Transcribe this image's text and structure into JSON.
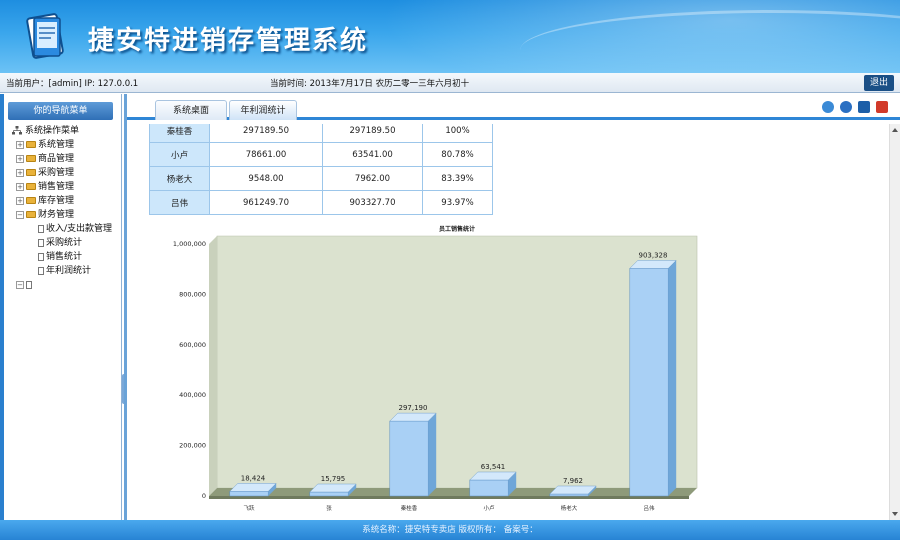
{
  "header": {
    "app_title": "捷安特进销存管理系统"
  },
  "infobar": {
    "current_user": "当前用户：[admin] IP: 127.0.0.1",
    "current_time": "当前时间:  2013年7月17日  农历二零一三年六月初十",
    "logout_label": "退出"
  },
  "sidebar": {
    "title": "你的导航菜单",
    "root_label": "系统操作菜单",
    "items": [
      {
        "label": "系统管理"
      },
      {
        "label": "商品管理"
      },
      {
        "label": "采购管理"
      },
      {
        "label": "销售管理"
      },
      {
        "label": "库存管理"
      },
      {
        "label": "财务管理"
      }
    ],
    "finance_children": [
      {
        "label": "收入/支出款管理"
      },
      {
        "label": "采购统计"
      },
      {
        "label": "销售统计"
      },
      {
        "label": "年利润统计"
      }
    ]
  },
  "tabs": [
    {
      "label": "系统桌面"
    },
    {
      "label": "年利润统计"
    }
  ],
  "table": {
    "rows": [
      {
        "name": "秦桂香",
        "v1": "297189.50",
        "v2": "297189.50",
        "v3": "100%"
      },
      {
        "name": "小卢",
        "v1": "78661.00",
        "v2": "63541.00",
        "v3": "80.78%"
      },
      {
        "name": "杨老大",
        "v1": "9548.00",
        "v2": "7962.00",
        "v3": "83.39%"
      },
      {
        "name": "吕伟",
        "v1": "961249.70",
        "v2": "903327.70",
        "v3": "93.97%"
      }
    ]
  },
  "chart_data": {
    "type": "bar",
    "title": "员工销售统计",
    "categories": [
      "飞跃",
      "张",
      "秦桂香",
      "小卢",
      "杨老大",
      "吕伟"
    ],
    "values": [
      18424,
      15795,
      297190,
      63541,
      7962,
      903328
    ],
    "value_labels": [
      "18,424",
      "15,795",
      "297,190",
      "63,541",
      "7,962",
      "903,328"
    ],
    "ylim": [
      0,
      1000000
    ],
    "yticks": [
      0,
      200000,
      400000,
      600000,
      800000,
      1000000
    ],
    "ytick_labels": [
      "0",
      "200,000",
      "400,000",
      "600,000",
      "800,000",
      "1,000,000"
    ],
    "grid": false,
    "colors": {
      "bar": "#a9d0f5",
      "bar_side": "#6fa6d8",
      "plot_bg": "#dbe2cf",
      "floor": "#8e9a7a"
    }
  },
  "footer": {
    "text": "系统名称：捷安特专卖店    版权所有：    备案号："
  }
}
